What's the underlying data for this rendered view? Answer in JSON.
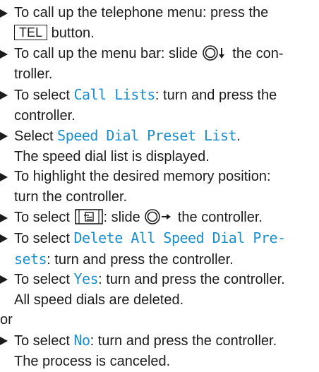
{
  "steps": [
    {
      "a": "To call up the telephone menu: press the",
      "key": "TEL",
      "b": "button."
    },
    {
      "a": "To call up the menu bar: slide",
      "b": "the con-",
      "c": "troller."
    },
    {
      "a": "To select ",
      "hl": "Call Lists",
      "b": ": turn and press the",
      "c": "controller."
    },
    {
      "a": "Select ",
      "hl": "Speed Dial Preset List",
      "b": ".",
      "c": "The speed dial list is displayed."
    },
    {
      "a": "To highlight the desired memory position:",
      "b": "turn the controller."
    },
    {
      "a": "To select",
      "b": ": slide",
      "c": "the controller."
    },
    {
      "a": "To select ",
      "hl": "Delete All Speed Dial Pre-",
      "hl2": "sets",
      "b": ": turn and press the controller."
    },
    {
      "a": "To select ",
      "hl": "Yes",
      "b": ": turn and press the controller.",
      "c": "All speed dials are deleted."
    },
    {
      "a": "To select ",
      "hl": "No",
      "b": ": turn and press the controller.",
      "c": "The process is canceled."
    }
  ],
  "or_label": "or",
  "icons": {
    "controller_slide_down": "controller-slide-down-icon",
    "controller_slide_right": "controller-slide-right-icon",
    "options_key": "options-key-icon"
  },
  "colors": {
    "highlight": "#1a8fcf",
    "text": "#1c1c1c"
  }
}
